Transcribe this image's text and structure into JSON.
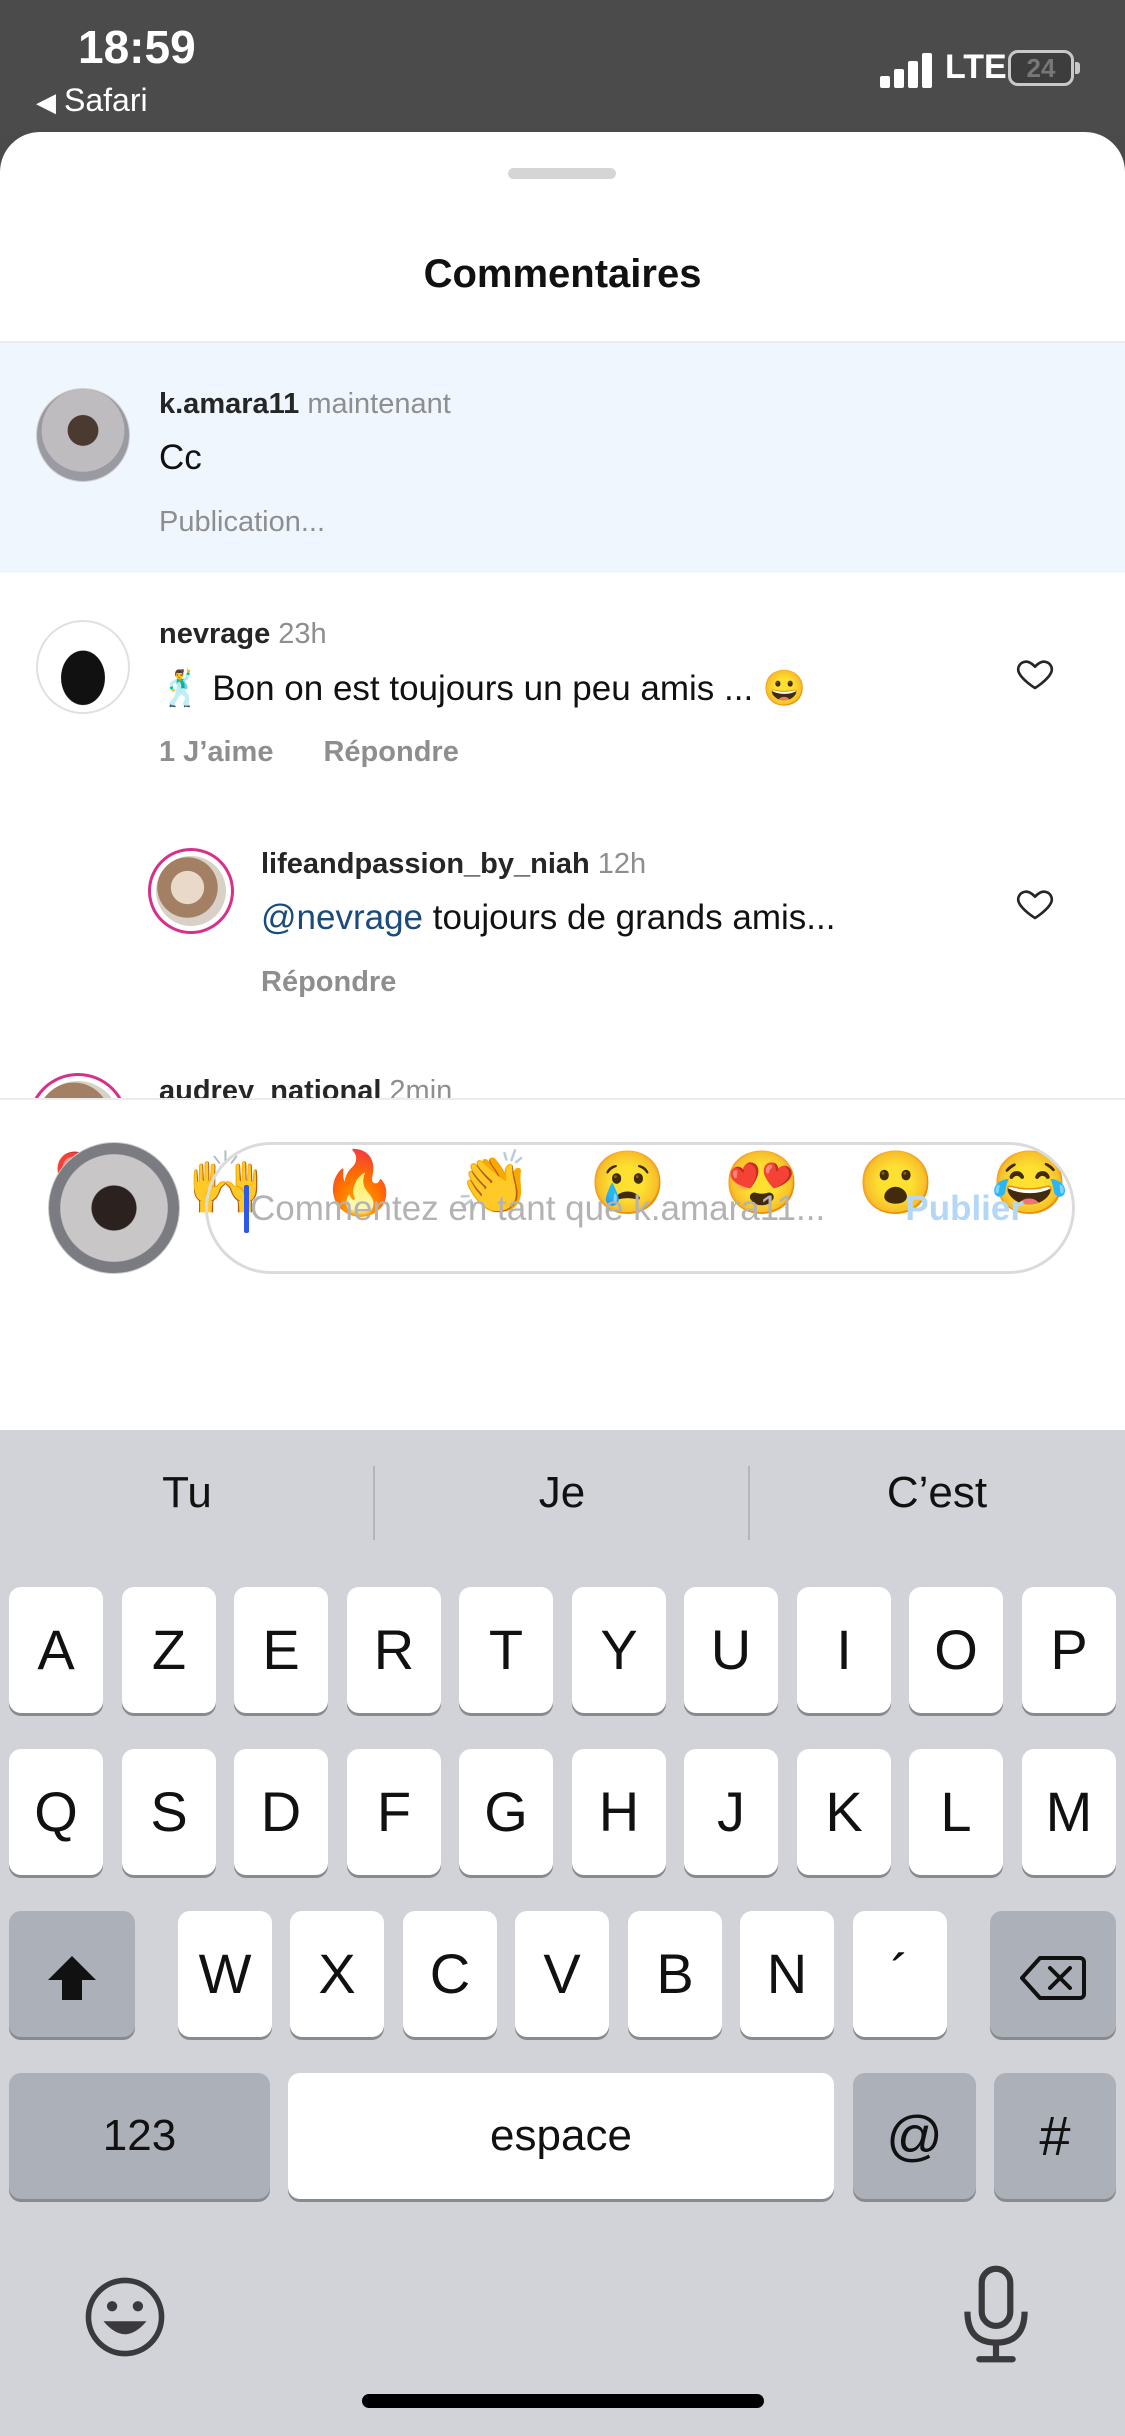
{
  "status": {
    "time": "18:59",
    "back_label": "Safari",
    "network": "LTE",
    "battery": "24"
  },
  "sheet": {
    "title": "Commentaires",
    "comments": [
      {
        "user": "k.amara11",
        "time": "maintenant",
        "text": "Cc",
        "status": "Publication..."
      },
      {
        "user": "nevrage",
        "time": "23h",
        "text": "🕺 Bon on est toujours un peu amis ... 😀",
        "likes": "1 J’aime",
        "reply": "Répondre"
      },
      {
        "user": "lifeandpassion_by_niah",
        "time": "12h",
        "mention": "@nevrage",
        "text": " toujours de grands amis...",
        "reply": "Répondre"
      },
      {
        "user": "audrey_national",
        "time": "2min"
      }
    ],
    "emojis": [
      "❤️",
      "🙌",
      "🔥",
      "👏",
      "😢",
      "😍",
      "😮",
      "😂"
    ],
    "input": {
      "placeholder": "Commentez en tant que k.amara11...",
      "publish": "Publier"
    }
  },
  "keyboard": {
    "suggestions": [
      "Tu",
      "Je",
      "C’est"
    ],
    "row1": [
      "A",
      "Z",
      "E",
      "R",
      "T",
      "Y",
      "U",
      "I",
      "O",
      "P"
    ],
    "row2": [
      "Q",
      "S",
      "D",
      "F",
      "G",
      "H",
      "J",
      "K",
      "L",
      "M"
    ],
    "row3": [
      "W",
      "X",
      "C",
      "V",
      "B",
      "N",
      "´"
    ],
    "numbers": "123",
    "space": "espace",
    "at": "@",
    "hash": "#"
  },
  "colors": {
    "highlight": "#eff6fd",
    "publish": "#b5d7f6",
    "mention": "#1a4b7a",
    "keyboard_bg": "#d1d3d9"
  }
}
